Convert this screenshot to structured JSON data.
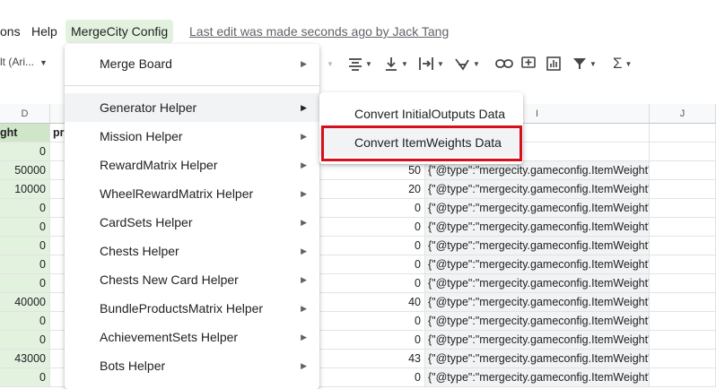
{
  "menubar": {
    "items": [
      "ons",
      "Help",
      "MergeCity Config"
    ],
    "last_edit": "Last edit was made seconds ago by Jack Tang"
  },
  "toolbar": {
    "font": "lt (Ari...",
    "icons": [
      "align-icon",
      "valign-icon",
      "wrap-icon",
      "rotate-icon",
      "link-icon",
      "comment-icon",
      "chart-icon",
      "filter-icon",
      "function-icon"
    ]
  },
  "columns": {
    "d": "D",
    "i": "I",
    "j": "J"
  },
  "header_row": {
    "d": "ght",
    "e": "pr"
  },
  "rows": [
    {
      "d": "0",
      "h": "",
      "i": ""
    },
    {
      "d": "50000",
      "h": "50",
      "i": "{\"@type\":\"mergecity.gameconfig.ItemWeight\",\"groupId"
    },
    {
      "d": "10000",
      "h": "20",
      "i": "{\"@type\":\"mergecity.gameconfig.ItemWeight\",\"groupId"
    },
    {
      "d": "0",
      "h": "0",
      "i": "{\"@type\":\"mergecity.gameconfig.ItemWeight\",\"groupId"
    },
    {
      "d": "0",
      "h": "0",
      "i": "{\"@type\":\"mergecity.gameconfig.ItemWeight\",\"groupId"
    },
    {
      "d": "0",
      "h": "0",
      "i": "{\"@type\":\"mergecity.gameconfig.ItemWeight\",\"groupId"
    },
    {
      "d": "0",
      "h": "0",
      "i": "{\"@type\":\"mergecity.gameconfig.ItemWeight\",\"groupId"
    },
    {
      "d": "0",
      "h": "0",
      "i": "{\"@type\":\"mergecity.gameconfig.ItemWeight\",\"groupId"
    },
    {
      "d": "40000",
      "h": "40",
      "i": "{\"@type\":\"mergecity.gameconfig.ItemWeight\",\"groupId"
    },
    {
      "d": "0",
      "h": "0",
      "i": "{\"@type\":\"mergecity.gameconfig.ItemWeight\",\"groupId"
    },
    {
      "d": "0",
      "h": "0",
      "i": "{\"@type\":\"mergecity.gameconfig.ItemWeight\",\"groupId"
    },
    {
      "d": "43000",
      "h": "43",
      "i": "{\"@type\":\"mergecity.gameconfig.ItemWeight\",\"groupId"
    },
    {
      "d": "0",
      "h": "0",
      "i": "{\"@type\":\"mergecity.gameconfig.ItemWeight\",\"groupId"
    }
  ],
  "menu": {
    "items": [
      "Merge Board",
      "Generator Helper",
      "Mission Helper",
      "RewardMatrix Helper",
      "WheelRewardMatrix Helper",
      "CardSets Helper",
      "Chests Helper",
      "Chests New Card Helper",
      "BundleProductsMatrix Helper",
      "AchievementSets Helper",
      "Bots Helper"
    ]
  },
  "submenu": {
    "items": [
      "Convert InitialOutputs Data",
      "Convert ItemWeights Data"
    ]
  },
  "colors": {
    "highlight": "#d4101b",
    "menu_active": "#e3f1df",
    "col_green": "#e3f1df"
  }
}
